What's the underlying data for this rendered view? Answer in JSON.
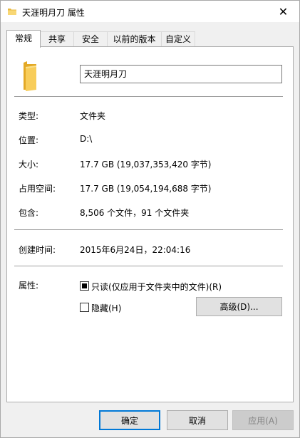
{
  "window": {
    "title": "天涯明月刀 属性",
    "close_glyph": "✕"
  },
  "tabs": [
    {
      "label": "常规",
      "active": true
    },
    {
      "label": "共享"
    },
    {
      "label": "安全"
    },
    {
      "label": "以前的版本"
    },
    {
      "label": "自定义"
    }
  ],
  "general": {
    "name": "天涯明月刀",
    "type_label": "类型:",
    "type_value": "文件夹",
    "location_label": "位置:",
    "location_value": "D:\\",
    "size_label": "大小:",
    "size_value": "17.7 GB (19,037,353,420 字节)",
    "disk_size_label": "占用空间:",
    "disk_size_value": "17.7 GB (19,054,194,688 字节)",
    "contains_label": "包含:",
    "contains_value": "8,506 个文件，91 个文件夹",
    "created_label": "创建时间:",
    "created_value": "2015年6月24日，22:04:16",
    "attributes_label": "属性:",
    "readonly_label": "只读(仅应用于文件夹中的文件)(R)",
    "hidden_label": "隐藏(H)",
    "advanced_button": "高级(D)..."
  },
  "footer": {
    "ok": "确定",
    "cancel": "取消",
    "apply": "应用(A)"
  },
  "colors": {
    "folder": "#f5c242",
    "primary_border": "#0078d7"
  }
}
